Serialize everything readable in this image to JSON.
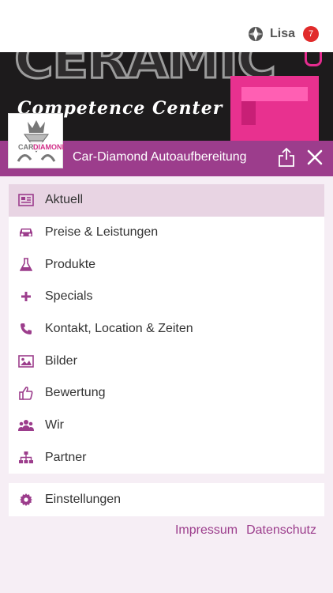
{
  "user": {
    "name": "Lisa",
    "badge_count": "7"
  },
  "hero": {
    "ceramic_text": "CERAMIC",
    "subtitle": "Competence Center"
  },
  "header": {
    "title": "Car-Diamond Autoaufbereitung"
  },
  "brand": {
    "logo_text": "CAR DIAMOND"
  },
  "menu": {
    "items": [
      {
        "label": "Aktuell",
        "icon": "news-icon",
        "active": true
      },
      {
        "label": "Preise & Leistungen",
        "icon": "car-icon"
      },
      {
        "label": "Produkte",
        "icon": "flask-icon"
      },
      {
        "label": "Specials",
        "icon": "plus-icon"
      },
      {
        "label": "Kontakt, Location & Zeiten",
        "icon": "phone-icon"
      },
      {
        "label": "Bilder",
        "icon": "image-icon"
      },
      {
        "label": "Bewertung",
        "icon": "thumbs-up-icon"
      },
      {
        "label": "Wir",
        "icon": "group-icon"
      },
      {
        "label": "Partner",
        "icon": "sitemap-icon"
      }
    ],
    "settings": {
      "label": "Einstellungen",
      "icon": "gear-icon"
    }
  },
  "footer": {
    "impressum": "Impressum",
    "datenschutz": "Datenschutz"
  },
  "colors": {
    "accent": "#9c3d8c",
    "active_bg": "#e8d4e3",
    "badge": "#e12b2b"
  }
}
